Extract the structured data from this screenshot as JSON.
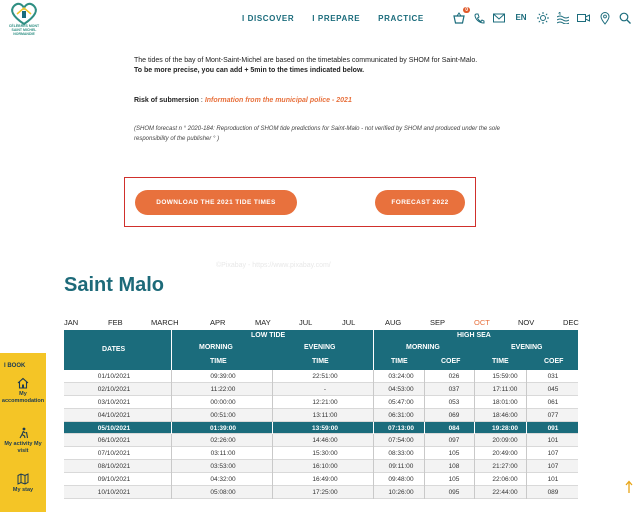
{
  "header": {
    "logo_text": "CÉLÈBRES MONT SAINT MICHEL NORMANDIE",
    "nav": [
      "I DISCOVER",
      "I PREPARE",
      "PRACTICE"
    ],
    "cart_count": "0",
    "language": "EN"
  },
  "intro": {
    "line1": "The tides of the bay of Mont-Saint-Michel are based on the timetables communicated by SHOM for Saint-Malo.",
    "line2": "To be more precise, you can add + 5min to the times indicated below."
  },
  "risk": {
    "label": "Risk of submersion",
    "sep": " : ",
    "link": "Information from the municipal police - 2021"
  },
  "shom_note": "(SHOM forecast n ° 2020-184: Reproduction of SHOM tide predictions for Saint-Malo - not verified by SHOM and produced under the sole responsibility of the publisher ° )",
  "buttons": {
    "download_2021": "DOWNLOAD THE 2021 TIDE TIMES",
    "forecast_2022": "FORECAST 2022"
  },
  "watermark": "©Pixabay - https://www.pixabay.com/",
  "city": "Saint Malo",
  "months": [
    "JAN",
    "FEB",
    "MARCH",
    "APR",
    "MAY",
    "JUL",
    "JUL",
    "AUG",
    "SEP",
    "OCT",
    "NOV",
    "DEC"
  ],
  "active_month_index": 9,
  "table": {
    "headers": {
      "dates": "DATES",
      "low_tide": "LOW TIDE",
      "high_sea": "HIGH SEA",
      "morning": "MORNING",
      "evening": "EVENING",
      "time": "TIME",
      "coef": "COEF"
    },
    "today_index": 4,
    "rows": [
      [
        "01/10/2021",
        "09:39:00",
        "22:51:00",
        "03:24:00",
        "026",
        "15:59:00",
        "031"
      ],
      [
        "02/10/2021",
        "11:22:00",
        "-",
        "04:53:00",
        "037",
        "17:11:00",
        "045"
      ],
      [
        "03/10/2021",
        "00:00:00",
        "12:21:00",
        "05:47:00",
        "053",
        "18:01:00",
        "061"
      ],
      [
        "04/10/2021",
        "00:51:00",
        "13:11:00",
        "06:31:00",
        "069",
        "18:46:00",
        "077"
      ],
      [
        "05/10/2021",
        "01:39:00",
        "13:59:00",
        "07:13:00",
        "084",
        "19:28:00",
        "091"
      ],
      [
        "06/10/2021",
        "02:26:00",
        "14:46:00",
        "07:54:00",
        "097",
        "20:09:00",
        "101"
      ],
      [
        "07/10/2021",
        "03:11:00",
        "15:30:00",
        "08:33:00",
        "105",
        "20:49:00",
        "107"
      ],
      [
        "08/10/2021",
        "03:53:00",
        "16:10:00",
        "09:11:00",
        "108",
        "21:27:00",
        "107"
      ],
      [
        "09/10/2021",
        "04:32:00",
        "16:49:00",
        "09:48:00",
        "105",
        "22:06:00",
        "101"
      ],
      [
        "10/10/2021",
        "05:08:00",
        "17:25:00",
        "10:26:00",
        "095",
        "22:44:00",
        "089"
      ]
    ]
  },
  "side_panel": {
    "title": "I BOOK",
    "items": [
      "My accommodation",
      "My activity My visit",
      "My stay"
    ]
  },
  "colors": {
    "teal": "#1b6c7c",
    "orange": "#e8713d",
    "yellow": "#f4c526",
    "red_box": "#d0302c"
  }
}
